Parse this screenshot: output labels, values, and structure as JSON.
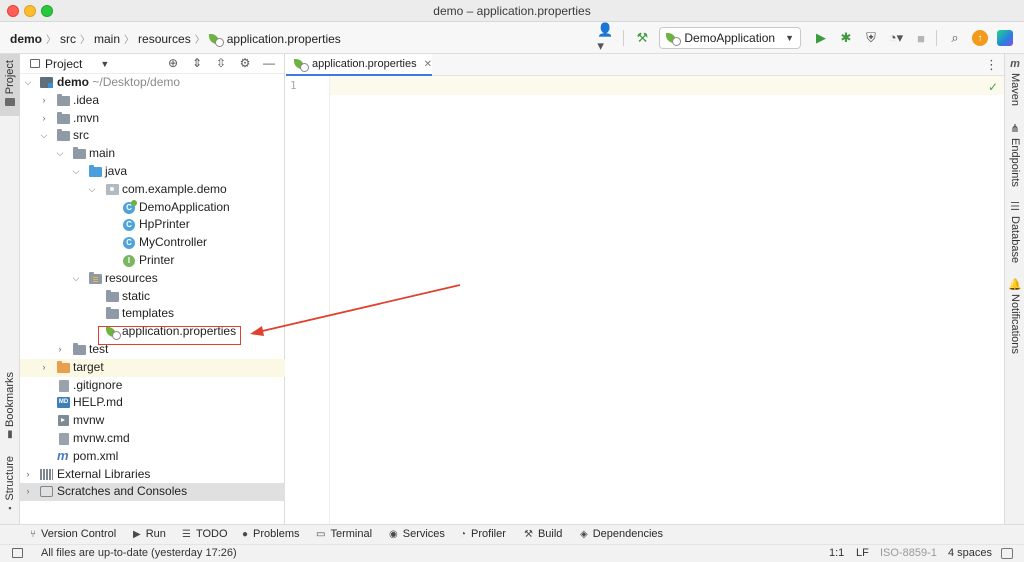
{
  "window": {
    "title": "demo – application.properties"
  },
  "breadcrumbs": [
    {
      "label": "demo",
      "bold": true
    },
    {
      "label": "src"
    },
    {
      "label": "main"
    },
    {
      "label": "resources"
    },
    {
      "label": "application.properties",
      "icon": "spring-properties-icon"
    }
  ],
  "toolbar": {
    "run_config": "DemoApplication"
  },
  "left_strip": {
    "project": "Project",
    "bookmarks": "Bookmarks",
    "structure": "Structure"
  },
  "right_strip": {
    "maven": "Maven",
    "maven_icon_glyph": "m",
    "endpoints": "Endpoints",
    "database": "Database",
    "notifications": "Notifications"
  },
  "project_panel": {
    "title": "Project"
  },
  "tree": {
    "root_name": "demo",
    "root_path": "~/Desktop/demo",
    "idea": ".idea",
    "mvn": ".mvn",
    "src": "src",
    "main": "main",
    "java": "java",
    "package": "com.example.demo",
    "demo_application": "DemoApplication",
    "hp_printer": "HpPrinter",
    "my_controller": "MyController",
    "printer": "Printer",
    "resources": "resources",
    "static": "static",
    "templates": "templates",
    "application_properties": "application.properties",
    "test": "test",
    "target": "target",
    "gitignore": ".gitignore",
    "help_md": "HELP.md",
    "mvnw": "mvnw",
    "mvnw_cmd": "mvnw.cmd",
    "pom_xml": "pom.xml",
    "external_libraries": "External Libraries",
    "scratches": "Scratches and Consoles"
  },
  "icons": {
    "class_glyph": "C",
    "interface_glyph": "I",
    "md_glyph": "MD"
  },
  "editor": {
    "tab_label": "application.properties",
    "line_number": "1"
  },
  "bottom_bar": {
    "version_control": "Version Control",
    "run": "Run",
    "todo": "TODO",
    "problems": "Problems",
    "terminal": "Terminal",
    "services": "Services",
    "profiler": "Profiler",
    "build": "Build",
    "dependencies": "Dependencies"
  },
  "status_bar": {
    "message": "All files are up-to-date (yesterday 17:26)",
    "position": "1:1",
    "line_sep": "LF",
    "encoding": "ISO-8859-1",
    "indent": "4 spaces"
  },
  "colors": {
    "accent_blue": "#3d7ae8",
    "spring_green": "#6db33f",
    "callout_red": "#e0402e",
    "selection_gray": "#e0e0e0"
  }
}
